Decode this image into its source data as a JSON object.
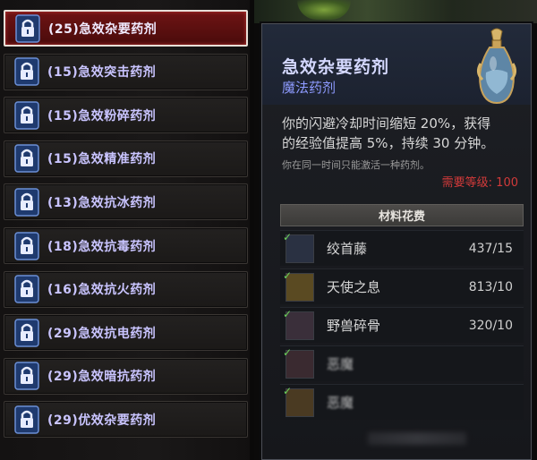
{
  "potion_list": [
    {
      "label": "(25)急效杂要药剂",
      "selected": true
    },
    {
      "label": "(15)急效突击药剂",
      "selected": false
    },
    {
      "label": "(15)急效粉碎药剂",
      "selected": false
    },
    {
      "label": "(15)急效精准药剂",
      "selected": false
    },
    {
      "label": "(13)急效抗冰药剂",
      "selected": false
    },
    {
      "label": "(18)急效抗毒药剂",
      "selected": false
    },
    {
      "label": "(16)急效抗火药剂",
      "selected": false
    },
    {
      "label": "(29)急效抗电药剂",
      "selected": false
    },
    {
      "label": "(29)急效暗抗药剂",
      "selected": false
    },
    {
      "label": "(29)优效杂要药剂",
      "selected": false
    }
  ],
  "tooltip": {
    "title": "急效杂要药剂",
    "subtitle": "魔法药剂",
    "desc_line1": "你的闪避冷却时间缩短 20%，获得",
    "desc_line2": "的经验值提高 5%，持续 30 分钟。",
    "note": "你在同一时间只能激活一种药剂。",
    "requirement": "需要等级: 100",
    "materials_header": "材料花费",
    "materials": [
      {
        "name": "绞首藤",
        "count": "437/15",
        "icon": "vine-icon",
        "obscured": false
      },
      {
        "name": "天使之息",
        "count": "813/10",
        "icon": "angel-breath-icon",
        "obscured": false
      },
      {
        "name": "野兽碎骨",
        "count": "320/10",
        "icon": "bone-icon",
        "obscured": false
      },
      {
        "name": "恶魔",
        "count": "",
        "icon": "demon-material-icon",
        "obscured": true
      },
      {
        "name": "恶魔",
        "count": "",
        "icon": "demon-material-icon",
        "obscured": true
      }
    ]
  },
  "colors": {
    "selected_bg": "#6e1414",
    "label": "#c9c4ff",
    "title": "#d4d8ff",
    "subtitle": "#8e9bff",
    "requirement": "#d13a3a",
    "check": "#6bd35a"
  }
}
